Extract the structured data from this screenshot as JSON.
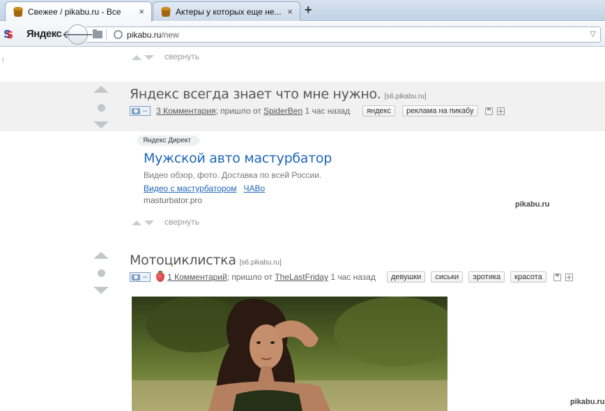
{
  "browser": {
    "tabs": [
      {
        "title": "Свежее / pikabu.ru - Все",
        "active": true
      },
      {
        "title": "Актеры у которых еще не...",
        "active": false
      }
    ],
    "new_tab": "+",
    "close_glyph": "×",
    "brand": "Яндекс",
    "url_host": "pikabu.ru",
    "url_path": "/new",
    "back_glyph": "🡐"
  },
  "page": {
    "collapse_label": "свернуть",
    "posts": [
      {
        "title": "Яндекс всегда знает что мне нужно.",
        "domain": "[s6.pikabu.ru]",
        "comments": "3 Комментария",
        "via": "; пришло от ",
        "author": "SpiderBen",
        "time": " 1 час назад",
        "tags": [
          "яндекс",
          "реклама на пикабу"
        ]
      },
      {
        "title": "Мотоциклистка",
        "domain": "[s6.pikabu.ru]",
        "comments": "1 Комментарий",
        "via": "; пришло от ",
        "author": "TheLastFriday",
        "time": " 1 час назад",
        "tags": [
          "девушки",
          "сиськи",
          "эротика",
          "красота"
        ]
      }
    ],
    "ad": {
      "badge": "Яндекс Директ",
      "title": "Мужской авто мастурбатор",
      "text": "Видео обзор, фото. Доставка по всей России.",
      "links": [
        "Видео с мастурбатором",
        "ЧАВо"
      ],
      "domain": "masturbator.pro"
    },
    "watermark": "pikabu.ru"
  },
  "colors": {
    "link": "#1f66b8",
    "tab_bg": "#c2d3e6",
    "post_bg": "#f1f1f1"
  }
}
